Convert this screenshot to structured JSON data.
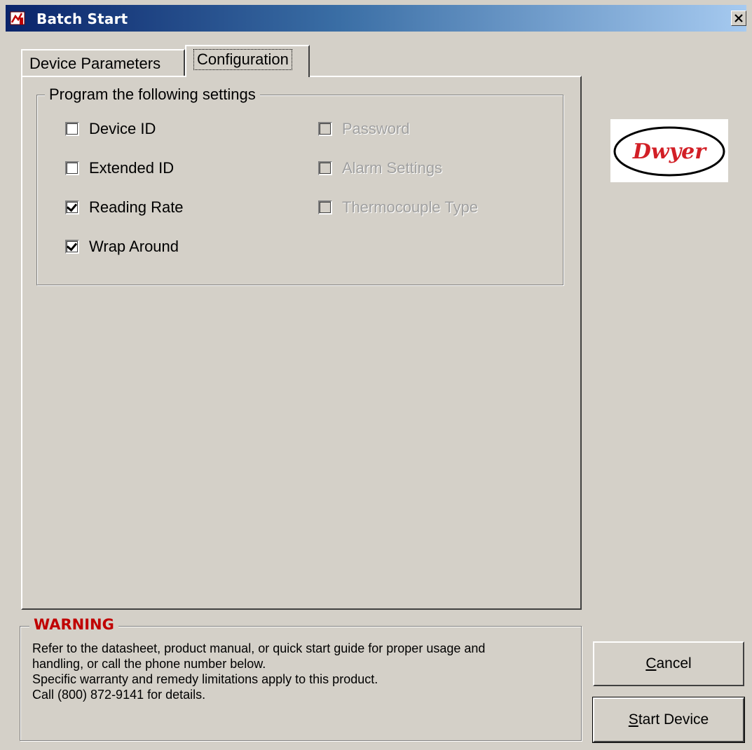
{
  "window": {
    "title": "Batch Start",
    "close_glyph": "×"
  },
  "tabs": [
    {
      "label": "Device Parameters",
      "active": false
    },
    {
      "label": "Configuration",
      "active": true
    }
  ],
  "settings_group": {
    "legend": "Program the following settings",
    "left_items": [
      {
        "label": "Device ID",
        "checked": false,
        "enabled": true
      },
      {
        "label": "Extended ID",
        "checked": false,
        "enabled": true
      },
      {
        "label": "Reading Rate",
        "checked": true,
        "enabled": true
      },
      {
        "label": "Wrap Around",
        "checked": true,
        "enabled": true
      }
    ],
    "right_items": [
      {
        "label": "Password",
        "checked": false,
        "enabled": false
      },
      {
        "label": "Alarm Settings",
        "checked": false,
        "enabled": false
      },
      {
        "label": "Thermocouple Type",
        "checked": false,
        "enabled": false
      }
    ]
  },
  "logo": {
    "text": "Dwyer",
    "color": "#d21f26"
  },
  "warning": {
    "title": "WARNING",
    "title_color": "#c00000",
    "lines": [
      "Refer to the datasheet, product manual, or quick start guide for proper usage and",
      "handling, or call the phone number below.",
      "Specific warranty and remedy limitations apply to this product.",
      "Call (800) 872-9141 for details."
    ]
  },
  "buttons": {
    "cancel": {
      "mnemonic": "C",
      "rest": "ancel"
    },
    "start": {
      "mnemonic": "S",
      "rest": "tart Device"
    }
  },
  "icons": {
    "app": "thermometer-app-icon",
    "close": "close-icon"
  }
}
